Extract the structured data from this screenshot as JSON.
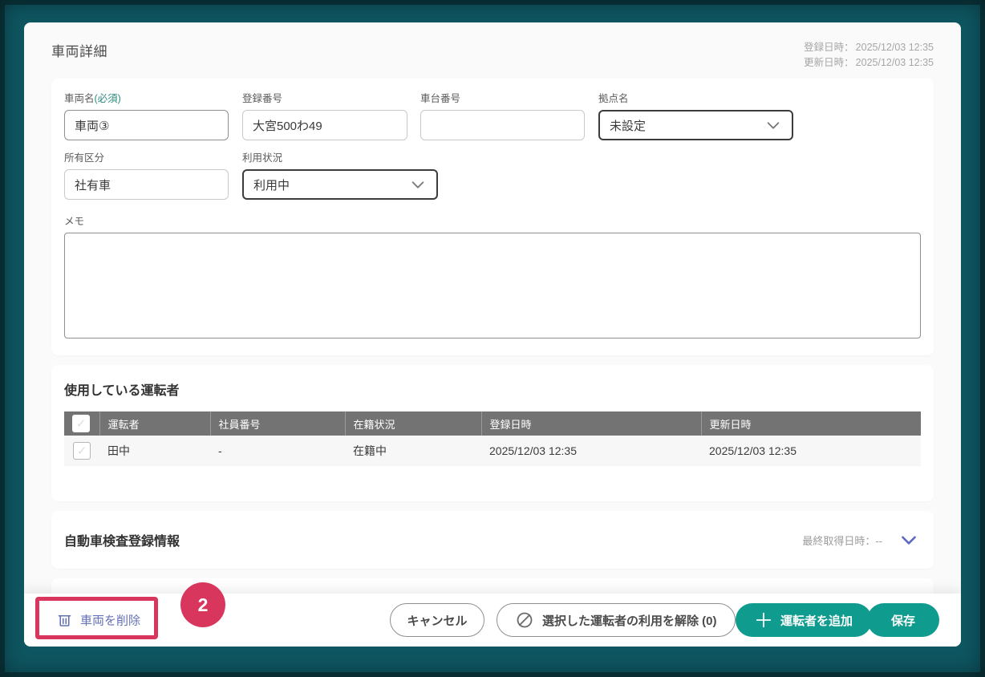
{
  "header": {
    "title": "車両詳細",
    "registered_label": "登録日時：",
    "registered_value": "2025/12/03 12:35",
    "updated_label": "更新日時：",
    "updated_value": "2025/12/03 12:35"
  },
  "form": {
    "vehicle_name_label": "車両名",
    "vehicle_name_required": "(必須)",
    "vehicle_name_value": "車両③",
    "registration_number_label": "登録番号",
    "registration_number_value": "大宮500わ49",
    "chassis_number_label": "車台番号",
    "chassis_number_value": "",
    "base_label": "拠点名",
    "base_value": "未設定",
    "ownership_label": "所有区分",
    "ownership_value": "社有車",
    "usage_label": "利用状況",
    "usage_value": "利用中",
    "memo_label": "メモ",
    "memo_value": ""
  },
  "drivers": {
    "title": "使用している運転者",
    "columns": [
      "運転者",
      "社員番号",
      "在籍状況",
      "登録日時",
      "更新日時"
    ],
    "rows": [
      [
        "田中",
        "-",
        "在籍中",
        "2025/12/03 12:35",
        "2025/12/03 12:35"
      ]
    ],
    "checkbox_glyph": "✓"
  },
  "inspection": {
    "title": "自動車検査登録情報",
    "last_fetched": "最終取得日時：--"
  },
  "footer": {
    "delete": "車両を削除",
    "cancel": "キャンセル",
    "release": "選択した運転者の利用を解除 (0)",
    "add_driver": "運転者を追加",
    "save": "保存"
  },
  "annotation": {
    "step": "2"
  },
  "icons": {
    "delete": "trash-icon",
    "release": "slash-circle-icon",
    "add": "plus-icon",
    "select": "chevron-down-icon",
    "accordion": "chevron-down-icon"
  },
  "colors": {
    "accent_teal": "#0f9b8e",
    "annotation_red": "#d8365d",
    "link_indigo": "#6470b5",
    "required_teal": "#2e8b80",
    "table_header_bg": "#737373",
    "frame_teal": "#0e5661"
  }
}
